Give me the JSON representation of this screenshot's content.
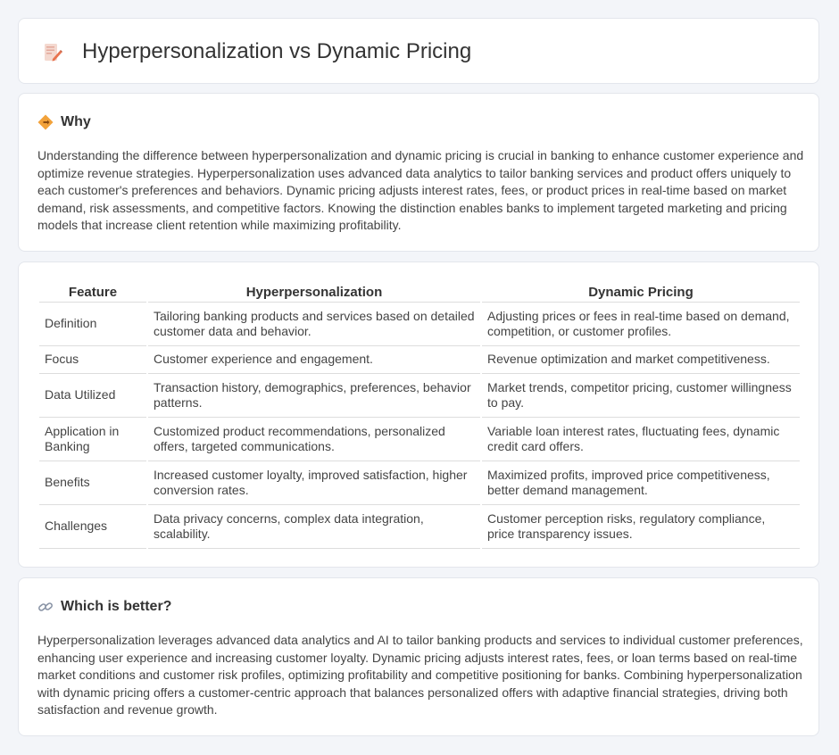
{
  "header": {
    "title": "Hyperpersonalization vs Dynamic Pricing",
    "icon": "document-pencil-icon"
  },
  "why": {
    "icon": "diamond-sign-icon",
    "title": "Why",
    "body": "Understanding the difference between hyperpersonalization and dynamic pricing is crucial in banking to enhance customer experience and optimize revenue strategies. Hyperpersonalization uses advanced data analytics to tailor banking services and product offers uniquely to each customer's preferences and behaviors. Dynamic pricing adjusts interest rates, fees, or product prices in real-time based on market demand, risk assessments, and competitive factors. Knowing the distinction enables banks to implement targeted marketing and pricing models that increase client retention while maximizing profitability."
  },
  "table": {
    "headers": [
      "Feature",
      "Hyperpersonalization",
      "Dynamic Pricing"
    ],
    "rows": [
      [
        "Definition",
        "Tailoring banking products and services based on detailed customer data and behavior.",
        "Adjusting prices or fees in real-time based on demand, competition, or customer profiles."
      ],
      [
        "Focus",
        "Customer experience and engagement.",
        "Revenue optimization and market competitiveness."
      ],
      [
        "Data Utilized",
        "Transaction history, demographics, preferences, behavior patterns.",
        "Market trends, competitor pricing, customer willingness to pay."
      ],
      [
        "Application in Banking",
        "Customized product recommendations, personalized offers, targeted communications.",
        "Variable loan interest rates, fluctuating fees, dynamic credit card offers."
      ],
      [
        "Benefits",
        "Increased customer loyalty, improved satisfaction, higher conversion rates.",
        "Maximized profits, improved price competitiveness, better demand management."
      ],
      [
        "Challenges",
        "Data privacy concerns, complex data integration, scalability.",
        "Customer perception risks, regulatory compliance, price transparency issues."
      ]
    ]
  },
  "better": {
    "icon": "link-icon",
    "title": "Which is better?",
    "body": "Hyperpersonalization leverages advanced data analytics and AI to tailor banking products and services to individual customer preferences, enhancing user experience and increasing customer loyalty. Dynamic pricing adjusts interest rates, fees, or loan terms based on real-time market conditions and customer risk profiles, optimizing profitability and competitive positioning for banks. Combining hyperpersonalization with dynamic pricing offers a customer-centric approach that balances personalized offers with adaptive financial strategies, driving both satisfaction and revenue growth."
  }
}
